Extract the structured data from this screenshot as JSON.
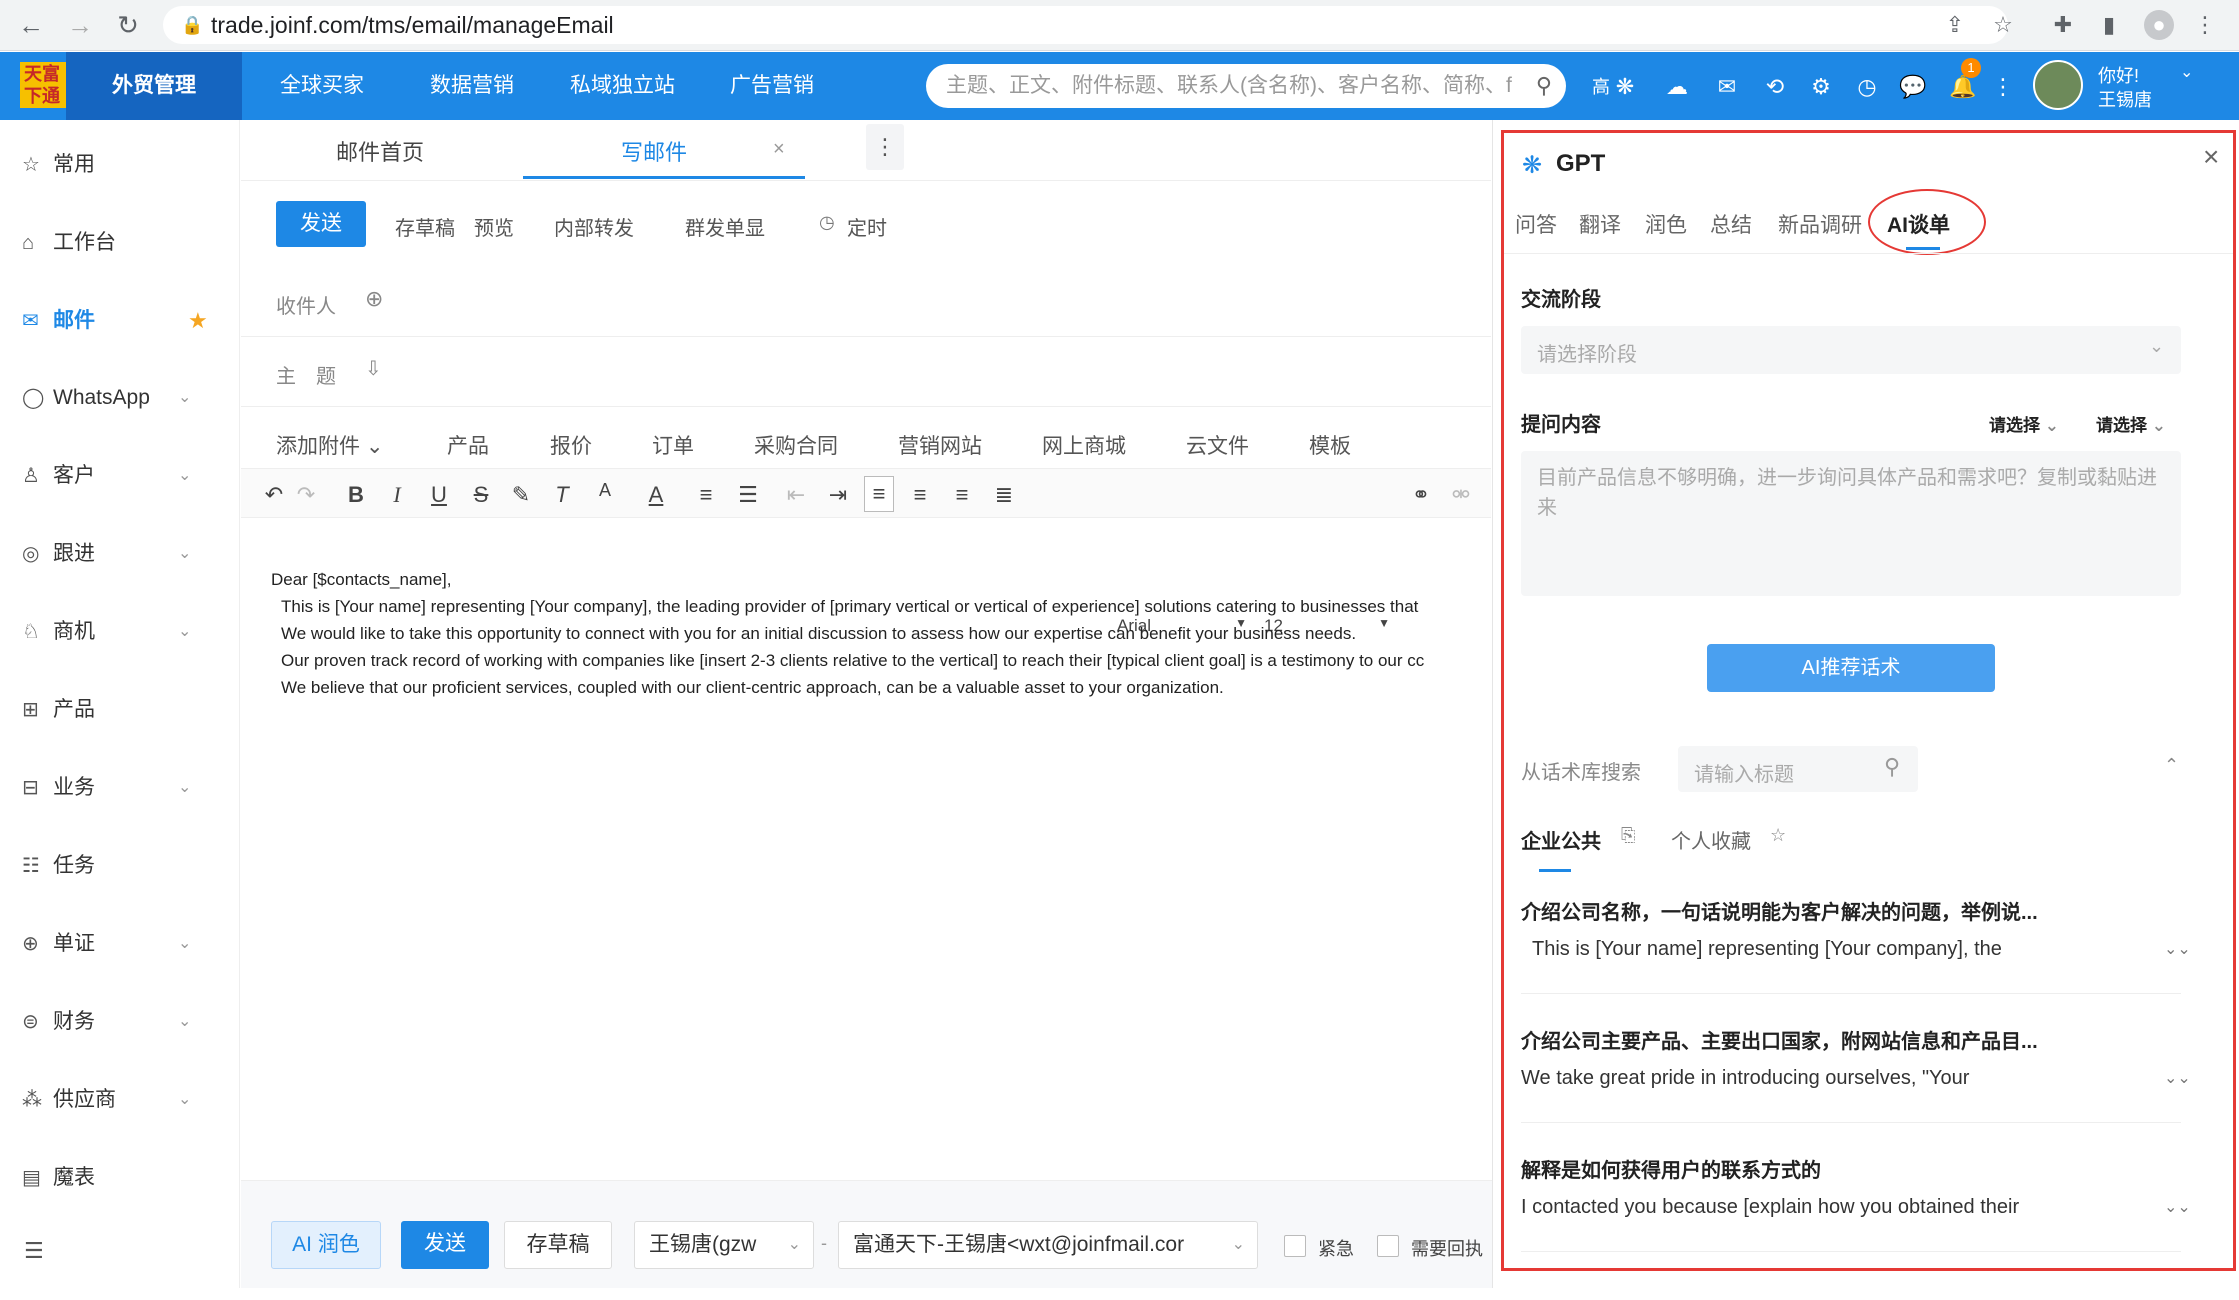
{
  "browser": {
    "url": "trade.joinf.com/tms/email/manageEmail",
    "icons": [
      "back-icon",
      "forward-icon",
      "reload-icon",
      "lock-icon",
      "share-icon",
      "star-icon",
      "extensions-icon",
      "sidepanel-icon",
      "profile-icon",
      "menu-icon"
    ]
  },
  "topnav": {
    "logo_text": "天富下通",
    "brand": "外贸管理",
    "items": [
      "全球买家",
      "数据营销",
      "私域独立站",
      "广告营销"
    ],
    "search_placeholder": "主题、正文、附件标题、联系人(含名称)、客户名称、简称、f",
    "ai_label": "高",
    "bell_count": "1",
    "greeting": "你好!",
    "user_name": "王锡唐"
  },
  "sidebar": {
    "items": [
      {
        "label": "常用",
        "icon": "star-outline-icon",
        "chevron": false
      },
      {
        "label": "工作台",
        "icon": "home-icon",
        "chevron": false
      },
      {
        "label": "邮件",
        "icon": "mail-icon",
        "chevron": false,
        "active": true
      },
      {
        "label": "WhatsApp",
        "icon": "whatsapp-icon",
        "chevron": true
      },
      {
        "label": "客户",
        "icon": "user-icon",
        "chevron": true
      },
      {
        "label": "跟进",
        "icon": "location-icon",
        "chevron": true
      },
      {
        "label": "商机",
        "icon": "opportunity-icon",
        "chevron": true
      },
      {
        "label": "产品",
        "icon": "grid-icon",
        "chevron": false
      },
      {
        "label": "业务",
        "icon": "briefcase-icon",
        "chevron": true
      },
      {
        "label": "任务",
        "icon": "task-icon",
        "chevron": false
      },
      {
        "label": "单证",
        "icon": "document-icon",
        "chevron": true
      },
      {
        "label": "财务",
        "icon": "finance-icon",
        "chevron": true
      },
      {
        "label": "供应商",
        "icon": "supplier-icon",
        "chevron": true
      },
      {
        "label": "魔表",
        "icon": "table-icon",
        "chevron": false
      }
    ]
  },
  "editor": {
    "tabs": [
      "邮件首页",
      "写邮件"
    ],
    "active_tab": "写邮件",
    "send": "发送",
    "toolbar": [
      "存草稿",
      "预览",
      "内部转发",
      "群发单显",
      "定时"
    ],
    "recipient_label": "收件人",
    "subject_label": "主　题",
    "attach_items": [
      "添加附件",
      "产品",
      "报价",
      "订单",
      "采购合同",
      "营销网站",
      "网上商城",
      "云文件",
      "模板"
    ],
    "font_family": "Arial",
    "font_size": "12",
    "body": [
      "Dear [$contacts_name],",
      "This is [Your name] representing [Your company], the leading provider of [primary vertical or vertical of experience] solutions catering to businesses that",
      "We would like to take this opportunity to connect with you for an initial discussion to assess how our expertise can benefit your business needs.",
      "Our proven track record of working with companies like [insert 2-3 clients relative to the vertical] to reach their [typical client goal] is a testimony to our cc",
      "We believe that our proficient services, coupled with our client-centric approach, can be a valuable asset to your organization."
    ]
  },
  "bottom": {
    "ai_polish": "AI 润色",
    "send": "发送",
    "draft": "存草稿",
    "sender": "王锡唐(gzw",
    "from": "富通天下-王锡唐<wxt@joinfmail.cor",
    "urgent": "紧急",
    "receipt": "需要回执"
  },
  "gpt": {
    "title": "GPT",
    "tabs": [
      "问答",
      "翻译",
      "润色",
      "总结",
      "新品调研",
      "AI谈单"
    ],
    "active_tab": "AI谈单",
    "stage_label": "交流阶段",
    "stage_placeholder": "请选择阶段",
    "question_label": "提问内容",
    "select1": "请选择",
    "select2": "请选择",
    "textarea_placeholder": "目前产品信息不够明确，进一步询问具体产品和需求吧？复制或黏贴进来",
    "recommend_button": "AI推荐话术",
    "library_label": "从话术库搜索",
    "library_placeholder": "请输入标题",
    "lib_tabs": [
      "企业公共",
      "个人收藏"
    ],
    "entries": [
      {
        "title": "介绍公司名称，一句话说明能为客户解决的问题，举例说...",
        "body": "This is [Your name] representing [Your company], the"
      },
      {
        "title": "介绍公司主要产品、主要出口国家，附网站信息和产品目...",
        "body": "We take great pride in introducing ourselves, \"Your"
      },
      {
        "title": "解释是如何获得用户的联系方式的",
        "body": "I contacted you because [explain how you obtained their"
      }
    ]
  }
}
